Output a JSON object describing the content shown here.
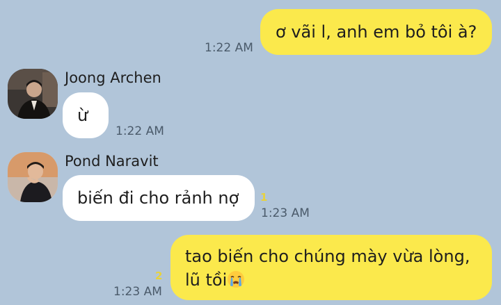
{
  "messages": [
    {
      "sender": "me",
      "text": "ơ vãi l, anh em bỏ tôi à?",
      "time": "1:22 AM"
    },
    {
      "sender": "Joong Archen",
      "text": "ừ",
      "time": "1:22 AM"
    },
    {
      "sender": "Pond Naravit",
      "text": "biến đi cho rảnh nợ",
      "time": "1:23 AM",
      "unread": "1"
    },
    {
      "sender": "me",
      "text_line1": "tao biến cho chúng mày vừa lòng,",
      "text_line2": "lũ tồi",
      "emoji": "crying-face-icon",
      "time": "1:23 AM",
      "unread": "2"
    }
  ],
  "colors": {
    "background": "#b1c5d9",
    "my_bubble": "#fbe94c",
    "their_bubble": "#ffffff",
    "unread": "#e8d23c"
  }
}
